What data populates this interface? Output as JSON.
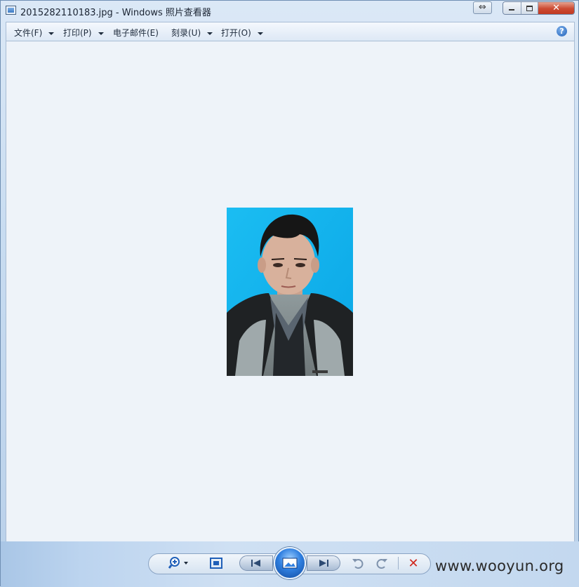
{
  "window": {
    "title": "2015282110183.jpg - Windows 照片查看器",
    "resize_glyph": "⇔",
    "close_glyph": "✕"
  },
  "menu": {
    "items": [
      {
        "label": "文件(F)",
        "has_dropdown": true
      },
      {
        "label": "打印(P)",
        "has_dropdown": true
      },
      {
        "label": "电子邮件(E)",
        "has_dropdown": false
      },
      {
        "label": "刻录(U)",
        "has_dropdown": true
      },
      {
        "label": "打开(O)",
        "has_dropdown": true
      }
    ],
    "help_glyph": "?"
  },
  "photo": {
    "subject": "id-photo-portrait",
    "background_color": "#14b3ec"
  },
  "toolbar": {
    "icons": [
      "zoom-icon",
      "fit-to-window-icon",
      "previous-icon",
      "slideshow-icon",
      "next-icon",
      "rotate-counterclockwise-icon",
      "rotate-clockwise-icon",
      "delete-icon"
    ],
    "delete_glyph": "✕"
  },
  "watermark": {
    "text": "www.wooyun.org"
  },
  "colors": {
    "accent": "#2f7fe0",
    "delete": "#d0281e",
    "viewer_background": "#eef3f9"
  }
}
